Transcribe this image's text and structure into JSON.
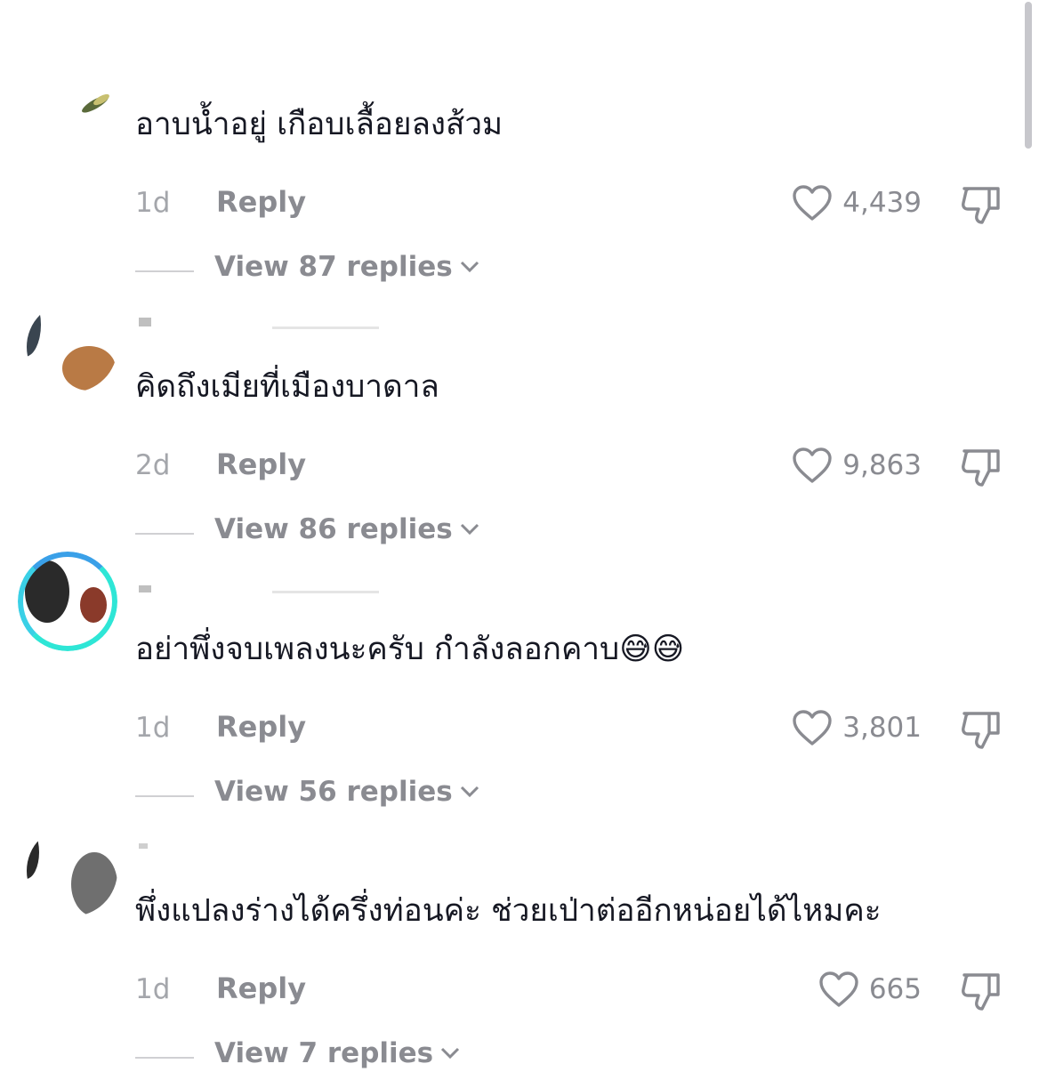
{
  "comments": [
    {
      "text": "อาบน้ำอยู่ เกือบเลื้อยลงส้วม",
      "time": "1d",
      "reply_label": "Reply",
      "likes": "4,439",
      "view_replies": "View 87 replies"
    },
    {
      "text": "คิดถึงเมียที่เมืองบาดาล",
      "time": "2d",
      "reply_label": "Reply",
      "likes": "9,863",
      "view_replies": "View 86 replies"
    },
    {
      "text": "อย่าพึ่งจบเพลงนะครับ กำลังลอกคาบ😅😅",
      "time": "1d",
      "reply_label": "Reply",
      "likes": "3,801",
      "view_replies": "View 56 replies"
    },
    {
      "text": "พึ่งแปลงร่างได้ครึ่งท่อนค่ะ ช่วยเป่าต่ออีกหน่อยได้ไหมคะ",
      "time": "1d",
      "reply_label": "Reply",
      "likes": "665",
      "view_replies": "View 7 replies"
    }
  ],
  "icons": {
    "like": "heart-outline-icon",
    "dislike": "thumbs-down-outline-icon",
    "expand": "chevron-down-icon"
  },
  "colors": {
    "text": "#161823",
    "muted": "#8a8b91",
    "story_ring": "#2ee6d6"
  }
}
